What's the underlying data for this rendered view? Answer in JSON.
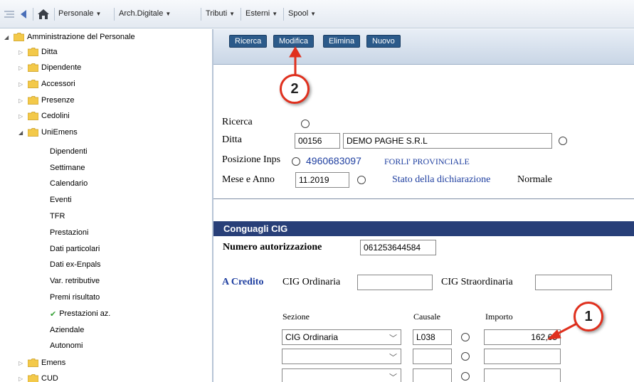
{
  "topbar": {
    "menus": [
      {
        "label": "Personale"
      },
      {
        "label": "Arch.Digitale"
      },
      {
        "label": "Tributi"
      },
      {
        "label": "Esterni"
      },
      {
        "label": "Spool"
      }
    ]
  },
  "tree": {
    "root": "Amministrazione del Personale",
    "folders_top": [
      "Ditta",
      "Dipendente",
      "Accessori",
      "Presenze",
      "Cedolini"
    ],
    "open_folder": "UniEmens",
    "leaves": [
      "Dipendenti",
      "Settimane",
      "Calendario",
      "Eventi",
      "TFR",
      "Prestazioni",
      "Dati particolari",
      "Dati ex-Enpals",
      "Var. retributive",
      "Premi risultato",
      "Prestazioni az.",
      "Aziendale",
      "Autonomi"
    ],
    "folders_bottom": [
      "Emens",
      "CUD"
    ]
  },
  "actions": {
    "ricerca": "Ricerca",
    "modifica": "Modifica",
    "elimina": "Elimina",
    "nuovo": "Nuovo"
  },
  "form": {
    "ricerca_label": "Ricerca",
    "ditta_label": "Ditta",
    "ditta_code": "00156",
    "ditta_name": "DEMO PAGHE S.R.L",
    "posizione_label": "Posizione Inps",
    "posizione_num": "4960683097",
    "posizione_desc": "FORLI' PROVINCIALE",
    "mese_label": "Mese e Anno",
    "mese_value": "11.2019",
    "stato_label": "Stato della dichiarazione",
    "stato_value": "Normale"
  },
  "cig": {
    "section_title": "Conguagli CIG",
    "numero_label": "Numero autorizzazione",
    "numero_value": "061253644584",
    "credito_label": "A Credito",
    "ordinaria_label": "CIG Ordinaria",
    "straordinaria_label": "CIG Straordinaria",
    "headers": {
      "sezione": "Sezione",
      "causale": "Causale",
      "importo": "Importo"
    },
    "rows": [
      {
        "sezione": "CIG Ordinaria",
        "causale": "L038",
        "importo": "162,65"
      },
      {
        "sezione": "",
        "causale": "",
        "importo": ""
      },
      {
        "sezione": "",
        "causale": "",
        "importo": ""
      }
    ]
  },
  "callouts": {
    "one": "1",
    "two": "2"
  },
  "colors": {
    "accent": "#2b5a8a",
    "section": "#283f78",
    "callout": "#e0301e",
    "link": "#1f3fa0"
  }
}
